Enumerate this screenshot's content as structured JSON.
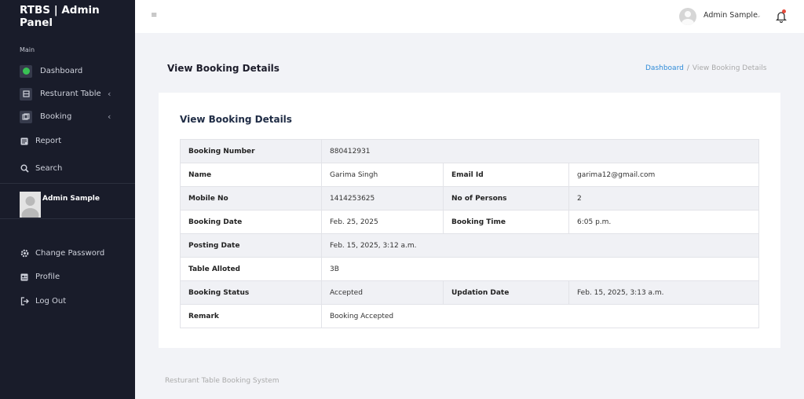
{
  "brand": "RTBS | Admin Panel",
  "sidebar": {
    "section_label": "Main",
    "items": [
      {
        "label": "Dashboard",
        "icon": "dashboard-icon"
      },
      {
        "label": "Resturant Table",
        "icon": "table-icon"
      },
      {
        "label": "Booking",
        "icon": "booking-icon"
      },
      {
        "label": "Report",
        "icon": "report-icon"
      },
      {
        "label": "Search",
        "icon": "search-icon"
      }
    ],
    "user_name": "Admin Sample",
    "bottom_items": [
      {
        "label": "Change Password",
        "icon": "gear-icon"
      },
      {
        "label": "Profile",
        "icon": "profile-icon"
      },
      {
        "label": "Log Out",
        "icon": "logout-icon"
      }
    ]
  },
  "topbar": {
    "user_name": "Admin Sample"
  },
  "page": {
    "title": "View Booking Details",
    "breadcrumb": {
      "home": "Dashboard",
      "current": "View Booking Details"
    }
  },
  "card": {
    "title": "View Booking Details",
    "rows": {
      "booking_number": {
        "label": "Booking Number",
        "value": "880412931"
      },
      "name": {
        "label": "Name",
        "value": "Garima Singh"
      },
      "email": {
        "label": "Email Id",
        "value": "garima12@gmail.com"
      },
      "mobile": {
        "label": "Mobile No",
        "value": "1414253625"
      },
      "persons": {
        "label": "No of Persons",
        "value": "2"
      },
      "booking_date": {
        "label": "Booking Date",
        "value": "Feb. 25, 2025"
      },
      "booking_time": {
        "label": "Booking Time",
        "value": "6:05 p.m."
      },
      "posting_date": {
        "label": "Posting Date",
        "value": "Feb. 15, 2025, 3:12 a.m."
      },
      "table_alloted": {
        "label": "Table Alloted",
        "value": "3B"
      },
      "booking_status": {
        "label": "Booking Status",
        "value": "Accepted"
      },
      "updation_date": {
        "label": "Updation Date",
        "value": "Feb. 15, 2025, 3:13 a.m."
      },
      "remark": {
        "label": "Remark",
        "value": "Booking Accepted"
      }
    }
  },
  "footer": "Resturant Table Booking System",
  "colors": {
    "sidebar_bg": "#191c2a",
    "accent_link": "#2f8bd8",
    "status_dot": "#39c154",
    "notification": "#e74c3c"
  }
}
